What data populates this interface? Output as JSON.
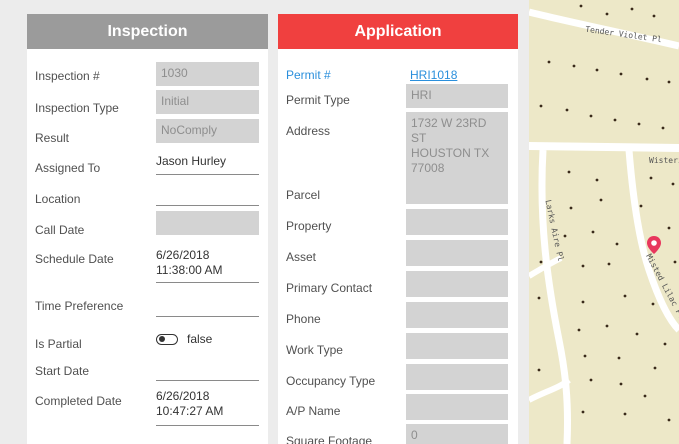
{
  "inspection": {
    "title": "Inspection",
    "fields": [
      {
        "label": "Inspection #",
        "value": "1030"
      },
      {
        "label": "Inspection Type",
        "value": "Initial"
      },
      {
        "label": "Result",
        "value": "NoComply"
      },
      {
        "label": "Assigned To",
        "value": "Jason Hurley"
      },
      {
        "label": "Location",
        "value": ""
      },
      {
        "label": "Call Date",
        "value": ""
      },
      {
        "label": "Schedule Date",
        "value_line1": "6/26/2018",
        "value_line2": "11:38:00 AM"
      },
      {
        "label": "Time Preference",
        "value": ""
      },
      {
        "label": "Is Partial",
        "value": "false"
      },
      {
        "label": "Start Date",
        "value": ""
      },
      {
        "label": "Completed Date",
        "value_line1": "6/26/2018",
        "value_line2": "10:47:27 AM"
      }
    ]
  },
  "application": {
    "title": "Application",
    "fields": [
      {
        "label": "Permit #",
        "value": "HRI1018"
      },
      {
        "label": "Permit Type",
        "value": "HRI"
      },
      {
        "label": "Address",
        "value_line1": "1732 W 23RD ST",
        "value_line2": "HOUSTON TX",
        "value_line3": "77008"
      },
      {
        "label": "Parcel",
        "value": ""
      },
      {
        "label": "Property",
        "value": ""
      },
      {
        "label": "Asset",
        "value": ""
      },
      {
        "label": "Primary Contact",
        "value": ""
      },
      {
        "label": "Phone",
        "value": ""
      },
      {
        "label": "Work Type",
        "value": ""
      },
      {
        "label": "Occupancy Type",
        "value": ""
      },
      {
        "label": "A/P Name",
        "value": ""
      },
      {
        "label": "Square Footage",
        "value": "0"
      }
    ]
  },
  "map": {
    "streets": [
      "Tender Violet Pl",
      "Wisteri",
      "Larks Aire Pl",
      "Misted Lilac Pl"
    ],
    "pin_color": "#e8365d"
  },
  "colors": {
    "inspection_header": "#9b9b9b",
    "application_header": "#f0403f",
    "link": "#2a8fdc"
  }
}
